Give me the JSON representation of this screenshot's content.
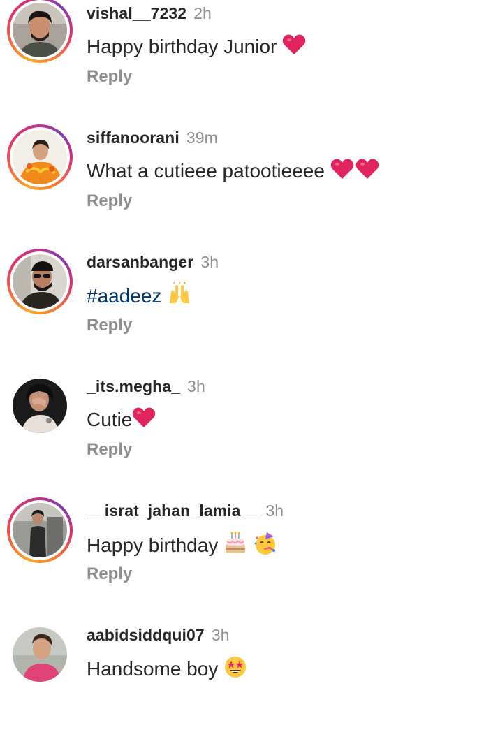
{
  "comments": [
    {
      "username": "vishal__7232",
      "time": "2h",
      "text": "Happy birthday Junior",
      "emojis": [
        "red-heart"
      ],
      "reply_label": "Reply",
      "has_story_ring": true
    },
    {
      "username": "siffanoorani",
      "time": "39m",
      "text": "What a cutieee patootieeee",
      "emojis": [
        "red-heart",
        "red-heart"
      ],
      "reply_label": "Reply",
      "has_story_ring": true
    },
    {
      "username": "darsanbanger",
      "time": "3h",
      "text": "#aadeez",
      "emojis": [
        "raising-hands"
      ],
      "reply_label": "Reply",
      "has_story_ring": true
    },
    {
      "username": "_its.megha_",
      "time": "3h",
      "text": "Cutie",
      "emojis": [
        "red-heart"
      ],
      "reply_label": "Reply",
      "has_story_ring": false
    },
    {
      "username": "__israt_jahan_lamia__",
      "time": "3h",
      "text": "Happy birthday",
      "emojis": [
        "birthday-cake",
        "partying-face"
      ],
      "reply_label": "Reply",
      "has_story_ring": true
    },
    {
      "username": "aabidsiddqui07",
      "time": "3h",
      "text": "Handsome boy",
      "emojis": [
        "star-struck"
      ],
      "reply_label": "",
      "has_story_ring": false
    }
  ],
  "colors": {
    "username": "#262626",
    "timestamp": "#8e8e8e",
    "reply": "#8e8e8e",
    "hashtag": "#00376b",
    "heart": "#e0245e"
  }
}
